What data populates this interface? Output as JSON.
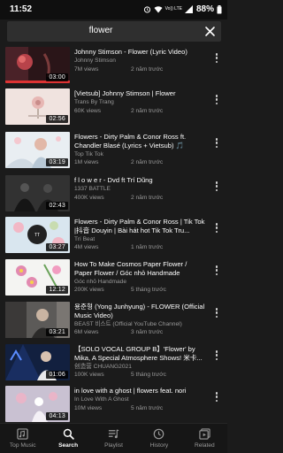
{
  "status_bar": {
    "time": "11:52",
    "volte": "Vo)) LTE",
    "battery": "88%"
  },
  "search": {
    "query": "flower"
  },
  "results": [
    {
      "title": "Johnny Stimson - Flower (Lyric Video)",
      "channel": "Johnny Stimson",
      "views": "7M views",
      "age": "2 năm trước",
      "duration": "03:00"
    },
    {
      "title": "[Vietsub] Johnny Stimson | Flower",
      "channel": "Trans By Trang",
      "views": "60K views",
      "age": "2 năm trước",
      "duration": "02:56"
    },
    {
      "title": "Flowers - Dirty Palm & Conor Ross ft. Chandler Blasé (Lyrics + Vietsub) 🎵",
      "channel": "Top Tik Tok",
      "views": "1M views",
      "age": "2 năm trước",
      "duration": "03:19"
    },
    {
      "title": "f l o w e r - Dvd ft Trí Dũng",
      "channel": "1337 BATTLE",
      "views": "400K views",
      "age": "2 năm trước",
      "duration": "02:43"
    },
    {
      "title": "Flowers - Dirty Palm & Conor Ross | Tik Tok |抖音 Douyin | Bài hát hot Tik Tok Tru...",
      "channel": "Trí Beat",
      "views": "4M views",
      "age": "1 năm trước",
      "duration": "03:27"
    },
    {
      "title": "How To Make Cosmos Paper Flower / Paper Flower / Góc nhỏ Handmade",
      "channel": "Góc nhỏ Handmade",
      "views": "200K views",
      "age": "5 tháng trước",
      "duration": "12:12"
    },
    {
      "title": "용준형 (Yong Junhyung) - FLOWER (Official Music Video)",
      "channel": "BEAST 비스트 (Official YouTube Channel)",
      "views": "6M views",
      "age": "3 năm trước",
      "duration": "03:21"
    },
    {
      "title": "【SOLO VOCAL GROUP B】'Flower' by Mika, A Special Atmosphere Shows! 米卡...",
      "channel": "创造营 CHUANG2021",
      "views": "100K views",
      "age": "5 tháng trước",
      "duration": "01:06"
    },
    {
      "title": "in love with a ghost | flowers feat. nori",
      "channel": "In Love With A Ghost",
      "views": "10M views",
      "age": "5 năm trước",
      "duration": "04:13"
    }
  ],
  "nav": [
    {
      "label": "Top Music",
      "icon": "top-music-icon"
    },
    {
      "label": "Search",
      "icon": "search-icon"
    },
    {
      "label": "Playlist",
      "icon": "playlist-icon"
    },
    {
      "label": "History",
      "icon": "history-icon"
    },
    {
      "label": "Related",
      "icon": "related-icon"
    }
  ],
  "colors": {
    "background": "#1b1b1b",
    "search_bar": "#2f2f2f",
    "secondary_text": "#9a9a9a"
  }
}
